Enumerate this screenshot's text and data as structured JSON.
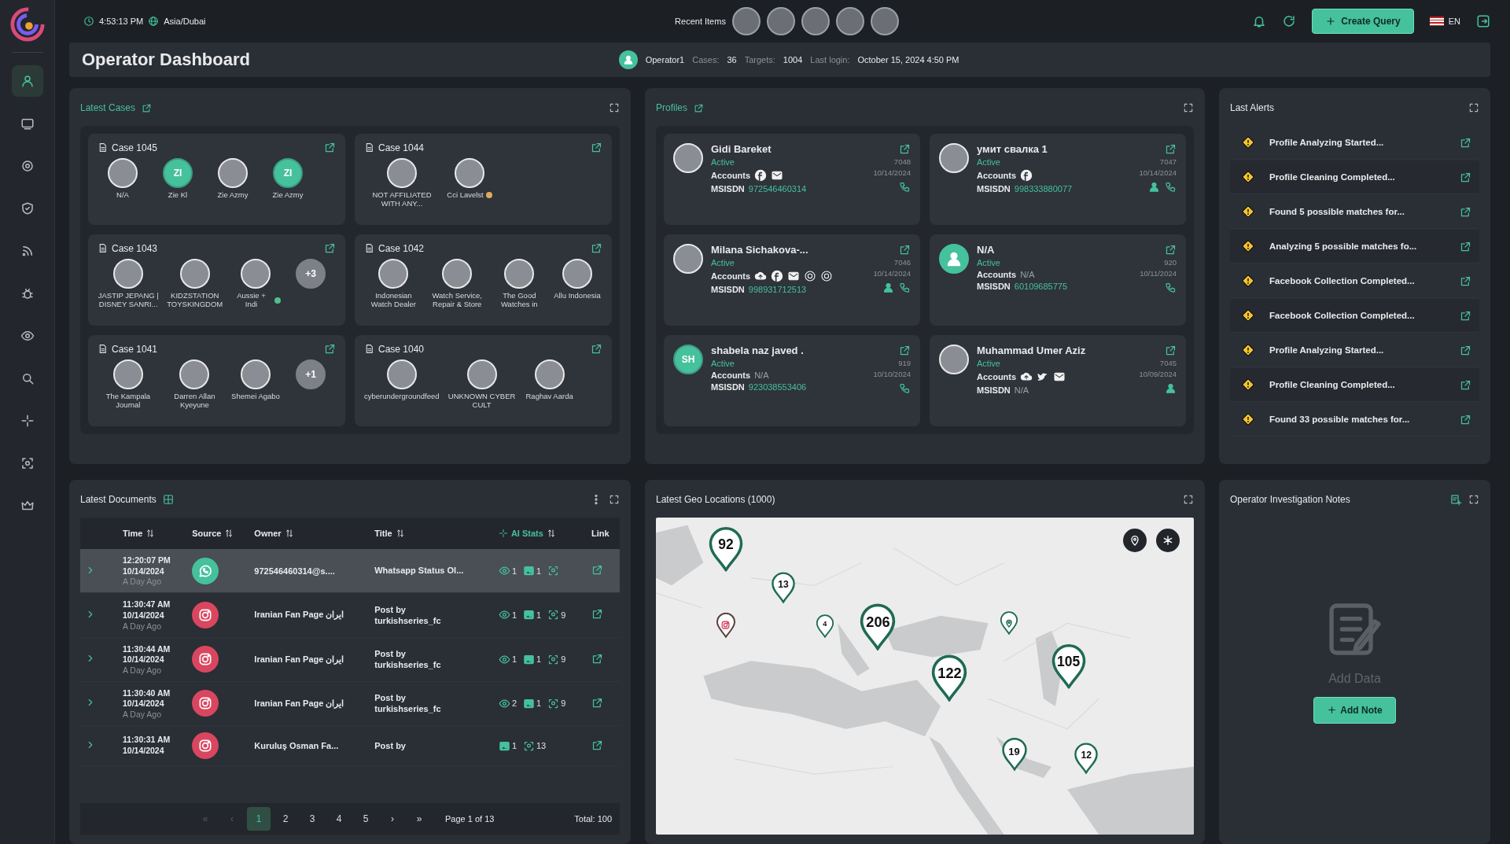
{
  "sidebar": {
    "items": [
      {
        "selected": true
      },
      {
        "selected": false
      },
      {
        "selected": false
      },
      {
        "selected": false
      },
      {
        "selected": false
      },
      {
        "selected": false
      },
      {
        "selected": false
      },
      {
        "selected": false
      },
      {
        "selected": false
      },
      {
        "selected": false
      },
      {
        "selected": false
      }
    ]
  },
  "top_bar": {
    "time": "4:53:13 PM",
    "timezone": "Asia/Dubai",
    "recent_label": "Recent Items",
    "recent_items": [
      {
        "kind": "photo"
      },
      {
        "kind": "photo"
      },
      {
        "kind": "photo"
      },
      {
        "kind": "photo"
      },
      {
        "kind": "photo"
      }
    ],
    "create_button": "Create Query",
    "language": "EN"
  },
  "header": {
    "title": "Operator Dashboard",
    "operator": "Operator1",
    "stats": [
      {
        "label": "Cases:",
        "value": "36"
      },
      {
        "label": "Targets:",
        "value": "1004"
      },
      {
        "label": "Last login:",
        "value": "October 15, 2024 4:50 PM"
      }
    ]
  },
  "latest_cases": {
    "title": "Latest Cases",
    "cases": [
      {
        "title": "Case 1045",
        "members": [
          {
            "kind": "photo",
            "name": "N/A"
          },
          {
            "kind": "initials",
            "initials": "ZI",
            "name": "Zie Kl"
          },
          {
            "kind": "photo",
            "name": "Zie Azmy"
          },
          {
            "kind": "initials",
            "initials": "ZI",
            "name": "Zie Azmy"
          }
        ]
      },
      {
        "title": "Case 1044",
        "members": [
          {
            "kind": "photo",
            "name": "NOT AFFILIATED WITH ANY..."
          },
          {
            "kind": "photo",
            "name": "Cci Lavelst",
            "color": "#e0a95a"
          }
        ]
      },
      {
        "title": "Case 1043",
        "members": [
          {
            "kind": "photo",
            "name": "JASTIP JEPANG | DISNEY SANRI..."
          },
          {
            "kind": "photo",
            "name": "KIDZSTATION TOYSKINGDOM"
          },
          {
            "kind": "photo",
            "name": "Aussie + Indi",
            "color": "#4fbf8f"
          },
          {
            "kind": "more",
            "initials": "+3"
          }
        ]
      },
      {
        "title": "Case 1042",
        "members": [
          {
            "kind": "photo",
            "name": "Indonesian Watch Dealer"
          },
          {
            "kind": "photo",
            "name": "Watch Service, Repair & Store"
          },
          {
            "kind": "photo",
            "name": "The Good Watches in"
          },
          {
            "kind": "photo",
            "name": "Allu Indonesia"
          }
        ]
      },
      {
        "title": "Case 1041",
        "members": [
          {
            "kind": "photo",
            "name": "The Kampala Journal"
          },
          {
            "kind": "photo",
            "name": "Darren Allan Kyeyune"
          },
          {
            "kind": "photo",
            "name": "Shemei Agabo"
          },
          {
            "kind": "more",
            "initials": "+1"
          }
        ]
      },
      {
        "title": "Case 1040",
        "members": [
          {
            "kind": "photo",
            "name": "cyberundergroundfeed"
          },
          {
            "kind": "photo",
            "name": "UNKNOWN CYBER CULT"
          },
          {
            "kind": "photo",
            "name": "Raghav Aarda"
          }
        ]
      }
    ]
  },
  "profiles": {
    "title": "Profiles",
    "cards": [
      {
        "kind": "photo",
        "name": "Gidi Bareket",
        "status": "Active",
        "accounts_label": "Accounts",
        "accounts": [
          {
            "kind": "f"
          },
          {
            "kind": "mail"
          }
        ],
        "msisdn_label": "MSISDN",
        "msisdn": "972546460314",
        "msisdn_missing": false,
        "id": "7048",
        "date": "10/14/2024",
        "actions": [
          {
            "kind": "phone"
          }
        ]
      },
      {
        "kind": "photo",
        "name": "умит свалка 1",
        "status": "Active",
        "accounts_label": "Accounts",
        "accounts": [
          {
            "kind": "f"
          }
        ],
        "msisdn_label": "MSISDN",
        "msisdn": "998333880077",
        "msisdn_missing": false,
        "id": "7047",
        "date": "10/14/2024",
        "actions": [
          {
            "kind": "person"
          },
          {
            "kind": "phone"
          }
        ]
      },
      {
        "kind": "photo",
        "name": "Milana Sichakova-...",
        "status": "Active",
        "accounts_label": "Accounts",
        "accounts": [
          {
            "kind": "cloud"
          },
          {
            "kind": "f"
          },
          {
            "kind": "mail"
          },
          {
            "kind": "ring"
          },
          {
            "kind": "ring"
          }
        ],
        "msisdn_label": "MSISDN",
        "msisdn": "998931712513",
        "msisdn_missing": false,
        "id": "7046",
        "date": "10/14/2024",
        "actions": [
          {
            "kind": "person"
          },
          {
            "kind": "phone"
          }
        ]
      },
      {
        "kind": "person",
        "name": "N/A",
        "status": "Active",
        "accounts_label": "Accounts",
        "accounts_none": "N/A",
        "msisdn_label": "MSISDN",
        "msisdn": "60109685775",
        "msisdn_missing": false,
        "id": "920",
        "date": "10/11/2024",
        "actions": [
          {
            "kind": "phone"
          }
        ]
      },
      {
        "kind": "initials",
        "initials": "SH",
        "name": "shabela naz javed .",
        "status": "Active",
        "accounts_label": "Accounts",
        "accounts_none": "N/A",
        "msisdn_label": "MSISDN",
        "msisdn": "923038553406",
        "msisdn_missing": false,
        "id": "919",
        "date": "10/10/2024",
        "actions": [
          {
            "kind": "phone"
          }
        ]
      },
      {
        "kind": "photo",
        "name": "Muhammad Umer Aziz",
        "status": "Active",
        "accounts_label": "Accounts",
        "accounts": [
          {
            "kind": "cloud"
          },
          {
            "kind": "bird"
          },
          {
            "kind": "mail"
          }
        ],
        "msisdn_label": "MSISDN",
        "msisdn": "N/A",
        "msisdn_missing": true,
        "id": "7045",
        "date": "10/09/2024",
        "actions": [
          {
            "kind": "person"
          }
        ]
      }
    ]
  },
  "last_alerts": {
    "title": "Last Alerts",
    "items": [
      {
        "text": "Profile Analyzing Started..."
      },
      {
        "text": "Profile Cleaning Completed..."
      },
      {
        "text": "Found 5 possible matches for..."
      },
      {
        "text": "Analyzing 5 possible matches fo..."
      },
      {
        "text": "Facebook Collection Completed..."
      },
      {
        "text": "Facebook Collection Completed..."
      },
      {
        "text": "Profile Analyzing Started..."
      },
      {
        "text": "Profile Cleaning Completed..."
      },
      {
        "text": "Found 33 possible matches for..."
      }
    ]
  },
  "latest_documents": {
    "title": "Latest Documents",
    "columns": [
      "Time",
      "Source",
      "Owner",
      "Title",
      "AI Stats",
      "Link"
    ],
    "rows": [
      {
        "selected": true,
        "time": "12:20:07 PM",
        "date": "10/14/2024",
        "ago": "A Day Ago",
        "kind": "chat",
        "owner": "972546460314@s....",
        "title": "Whatsapp Status Ol...",
        "stats": [
          {
            "kind": "eye",
            "value": "1"
          },
          {
            "kind": "image",
            "value": "1"
          },
          {
            "kind": "face"
          }
        ]
      },
      {
        "selected": false,
        "time": "11:30:47 AM",
        "date": "10/14/2024",
        "ago": "A Day Ago",
        "kind": "camera",
        "owner": "Iranian Fan Page ایران",
        "title": "Post by turkishseries_fc",
        "stats": [
          {
            "kind": "eye",
            "value": "1"
          },
          {
            "kind": "image",
            "value": "1"
          },
          {
            "kind": "face",
            "value": "9"
          }
        ]
      },
      {
        "selected": false,
        "time": "11:30:44 AM",
        "date": "10/14/2024",
        "ago": "A Day Ago",
        "kind": "camera",
        "owner": "Iranian Fan Page ایران",
        "title": "Post by turkishseries_fc",
        "stats": [
          {
            "kind": "eye",
            "value": "1"
          },
          {
            "kind": "image",
            "value": "1"
          },
          {
            "kind": "face",
            "value": "9"
          }
        ]
      },
      {
        "selected": false,
        "time": "11:30:40 AM",
        "date": "10/14/2024",
        "ago": "A Day Ago",
        "kind": "camera",
        "owner": "Iranian Fan Page ایران",
        "title": "Post by turkishseries_fc",
        "stats": [
          {
            "kind": "eye",
            "value": "2"
          },
          {
            "kind": "image",
            "value": "1"
          },
          {
            "kind": "face",
            "value": "9"
          }
        ]
      },
      {
        "selected": false,
        "time": "11:30:31 AM",
        "date": "10/14/2024",
        "kind": "camera",
        "owner": "Kuruluş Osman Fa...",
        "title": "Post by",
        "stats": [
          {
            "kind": "image",
            "value": "1"
          },
          {
            "kind": "face",
            "value": "13"
          }
        ]
      }
    ],
    "pages": [
      {
        "label": "«",
        "selected": false,
        "disabled": true
      },
      {
        "label": "‹",
        "selected": false,
        "disabled": true
      },
      {
        "label": "1",
        "selected": true,
        "disabled": false
      },
      {
        "label": "2",
        "selected": false,
        "disabled": false
      },
      {
        "label": "3",
        "selected": false,
        "disabled": false
      },
      {
        "label": "4",
        "selected": false,
        "disabled": false
      },
      {
        "label": "5",
        "selected": false,
        "disabled": false
      },
      {
        "label": "›",
        "selected": false,
        "disabled": false
      },
      {
        "label": "»",
        "selected": false,
        "disabled": false
      }
    ],
    "page_info": "Page 1 of 13",
    "total": "Total: 100"
  },
  "geo_locations": {
    "title": "Latest Geo Locations (1000)",
    "markers": [
      {
        "kind": "cluster",
        "count": "92"
      },
      {
        "kind": "cluster",
        "count": "13"
      },
      {
        "kind": "cluster",
        "count": "4"
      },
      {
        "kind": "cluster",
        "count": "206"
      },
      {
        "kind": "cluster",
        "count": "122"
      },
      {
        "kind": "cluster",
        "count": "105"
      },
      {
        "kind": "cluster",
        "count": "19"
      },
      {
        "kind": "cluster",
        "count": "12"
      },
      {
        "kind": "camera"
      },
      {
        "kind": "pin"
      }
    ]
  },
  "notes": {
    "title": "Operator Investigation Notes",
    "empty_text": "Add Data",
    "add_button": "Add Note"
  }
}
